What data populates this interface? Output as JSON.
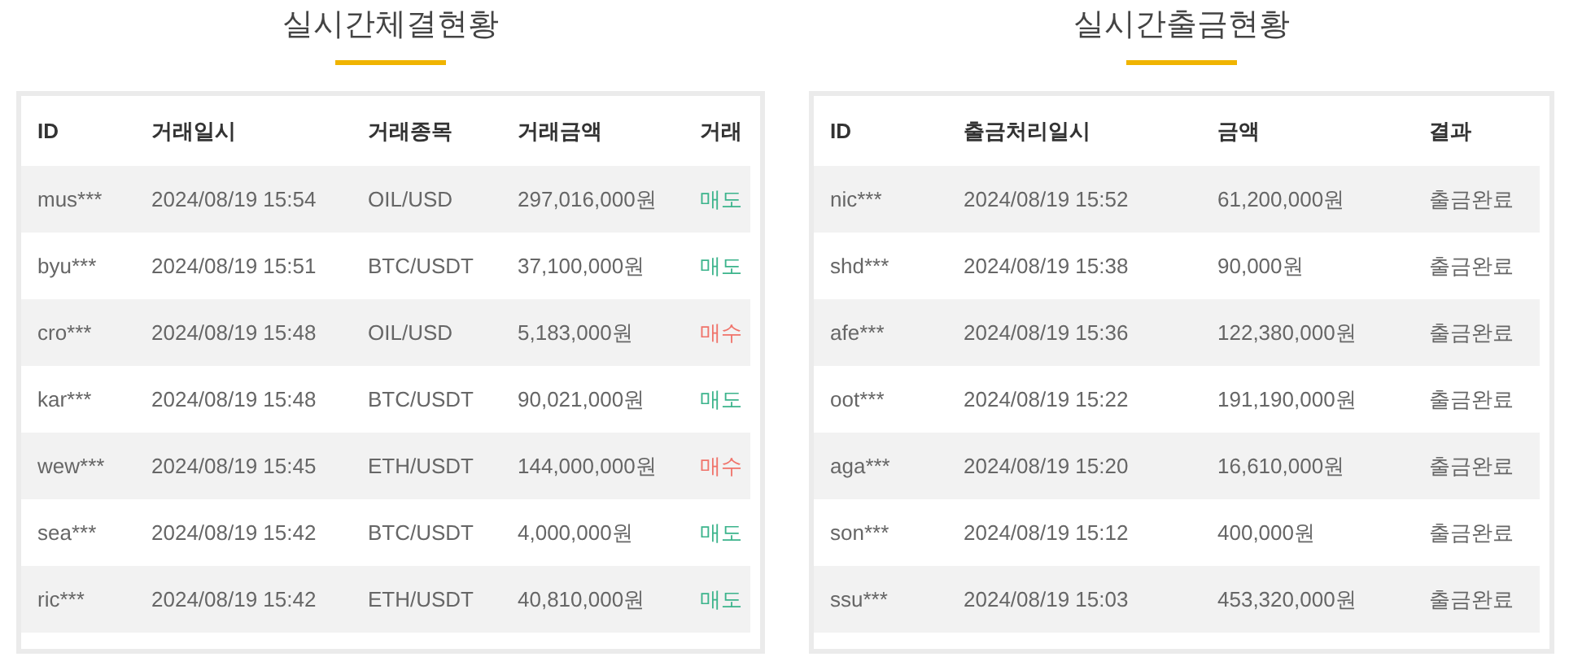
{
  "trades": {
    "title": "실시간체결현황",
    "columns": [
      "ID",
      "거래일시",
      "거래종목",
      "거래금액",
      "거래"
    ],
    "rows": [
      {
        "id": "mus***",
        "time": "2024/08/19 15:54",
        "symbol": "OIL/USD",
        "amount": "297,016,000원",
        "side": "매도",
        "kind": "sell"
      },
      {
        "id": "byu***",
        "time": "2024/08/19 15:51",
        "symbol": "BTC/USDT",
        "amount": "37,100,000원",
        "side": "매도",
        "kind": "sell"
      },
      {
        "id": "cro***",
        "time": "2024/08/19 15:48",
        "symbol": "OIL/USD",
        "amount": "5,183,000원",
        "side": "매수",
        "kind": "buy"
      },
      {
        "id": "kar***",
        "time": "2024/08/19 15:48",
        "symbol": "BTC/USDT",
        "amount": "90,021,000원",
        "side": "매도",
        "kind": "sell"
      },
      {
        "id": "wew***",
        "time": "2024/08/19 15:45",
        "symbol": "ETH/USDT",
        "amount": "144,000,000원",
        "side": "매수",
        "kind": "buy"
      },
      {
        "id": "sea***",
        "time": "2024/08/19 15:42",
        "symbol": "BTC/USDT",
        "amount": "4,000,000원",
        "side": "매도",
        "kind": "sell"
      },
      {
        "id": "ric***",
        "time": "2024/08/19 15:42",
        "symbol": "ETH/USDT",
        "amount": "40,810,000원",
        "side": "매도",
        "kind": "sell"
      }
    ]
  },
  "withdrawals": {
    "title": "실시간출금현황",
    "columns": [
      "ID",
      "출금처리일시",
      "금액",
      "결과"
    ],
    "rows": [
      {
        "id": "nic***",
        "time": "2024/08/19 15:52",
        "amount": "61,200,000원",
        "result": "출금완료"
      },
      {
        "id": "shd***",
        "time": "2024/08/19 15:38",
        "amount": "90,000원",
        "result": "출금완료"
      },
      {
        "id": "afe***",
        "time": "2024/08/19 15:36",
        "amount": "122,380,000원",
        "result": "출금완료"
      },
      {
        "id": "oot***",
        "time": "2024/08/19 15:22",
        "amount": "191,190,000원",
        "result": "출금완료"
      },
      {
        "id": "aga***",
        "time": "2024/08/19 15:20",
        "amount": "16,610,000원",
        "result": "출금완료"
      },
      {
        "id": "son***",
        "time": "2024/08/19 15:12",
        "amount": "400,000원",
        "result": "출금완료"
      },
      {
        "id": "ssu***",
        "time": "2024/08/19 15:03",
        "amount": "453,320,000원",
        "result": "출금완료"
      }
    ]
  }
}
